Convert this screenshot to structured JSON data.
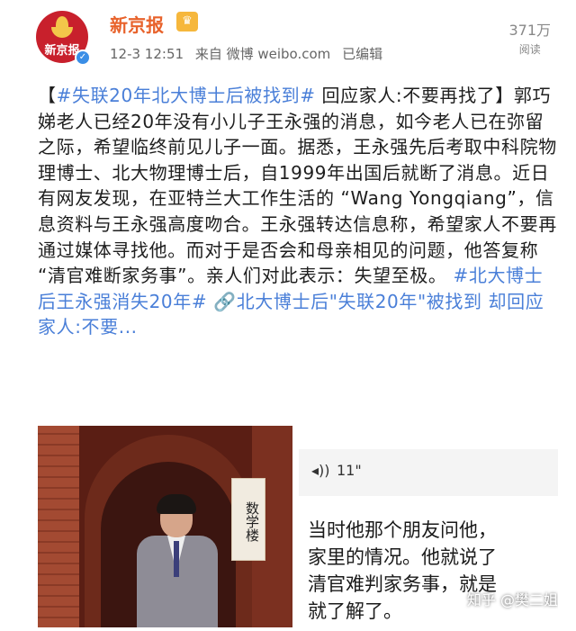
{
  "header": {
    "account_name": "新京报",
    "avatar_text": "新京报",
    "timestamp": "12-3 12:51",
    "source": "来自 微博 weibo.com",
    "edited": "已编辑",
    "reads_count": "371万",
    "reads_label": "阅读"
  },
  "post": {
    "open_bracket": "【",
    "topic1": "#失联20年北大博士后被找到#",
    "title_rest": " 回应家人:不要再找了",
    "close_bracket": "】",
    "body": "郭巧娣老人已经20年没有小儿子王永强的消息，如今老人已在弥留之际，希望临终前见儿子一面。据悉，王永强先后考取中科院物理博士、北大物理博士后，自1999年出国后就断了消息。近日有网友发现，在亚特兰大工作生活的 “Wang Yongqiang”，信息资料与王永强高度吻合。王永强转达信息称，希望家人不要再通过媒体寻找他。而对于是否会和母亲相见的问题，他答复称 “清官难断家务事”。亲人们对此表示：失望至极。",
    "topic2": "#北大博士后王永强消失20年#",
    "link_icon": "🔗",
    "link_text": "北大博士后\"失联20年\"被找到 却回应家人:不要..."
  },
  "media": {
    "photo_sign": "数学楼",
    "voice_duration": "11\"",
    "subtitle_lines": [
      "当时他那个朋友问他，",
      "家里的情况。他就说了",
      "清官难判家务事，就是",
      "就了解了。"
    ],
    "watermark": "知乎 @樊二姐"
  },
  "colors": {
    "brand": "#e8622b",
    "topic": "#4a7fd8",
    "avatar_bg": "#c8202c"
  },
  "icons": {
    "verified": "verified-badge-icon",
    "crown": "vip-crown-icon",
    "voice": "voice-wave-icon",
    "link": "link-icon"
  }
}
